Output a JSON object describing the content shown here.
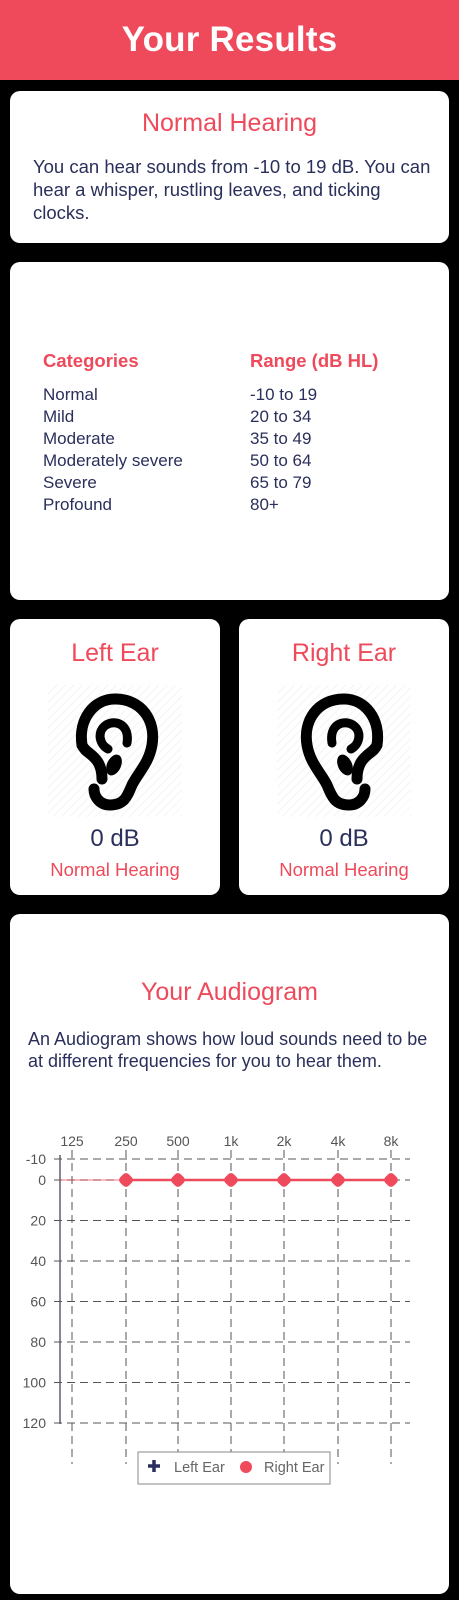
{
  "header": {
    "title": "Your Results"
  },
  "summary": {
    "title": "Normal Hearing",
    "description": "You can hear sounds from -10 to 19 dB. You can hear a whisper, rustling leaves, and ticking clocks."
  },
  "categories_table": {
    "col1_header": "Categories",
    "col2_header": "Range (dB HL)",
    "rows": [
      {
        "category": "Normal",
        "range": "-10 to 19"
      },
      {
        "category": "Mild",
        "range": "20 to 34"
      },
      {
        "category": "Moderate",
        "range": "35 to 49"
      },
      {
        "category": "Moderately severe",
        "range": "50 to 64"
      },
      {
        "category": "Severe",
        "range": "65 to 79"
      },
      {
        "category": "Profound",
        "range": "80+"
      }
    ]
  },
  "left_ear": {
    "title": "Left Ear",
    "icon": "ear-icon",
    "value": "0 dB",
    "status": "Normal Hearing"
  },
  "right_ear": {
    "title": "Right Ear",
    "icon": "ear-icon",
    "value": "0 dB",
    "status": "Normal Hearing"
  },
  "audiogram": {
    "title": "Your Audiogram",
    "description": "An Audiogram shows how loud sounds need to be at different frequencies for you to hear them."
  },
  "colors": {
    "accent": "#ee4a5b",
    "text": "#2a2f5b",
    "left_series": "#2a2f5b",
    "right_series": "#ee4a5b",
    "background": "#000000"
  },
  "chart_data": {
    "type": "line",
    "x": [
      "125",
      "250",
      "500",
      "1k",
      "2k",
      "4k",
      "8k"
    ],
    "y_ticks": [
      -10,
      0,
      20,
      40,
      60,
      80,
      100,
      120
    ],
    "ylim": [
      -10,
      120
    ],
    "y_inverted": true,
    "grid": true,
    "legend_position": "bottom",
    "series": [
      {
        "name": "Left Ear",
        "marker": "plus",
        "color": "#2a2f5b",
        "values": [
          null,
          null,
          null,
          null,
          null,
          null,
          null
        ]
      },
      {
        "name": "Right Ear",
        "marker": "circle",
        "color": "#ee4a5b",
        "values": [
          null,
          0,
          0,
          0,
          0,
          0,
          0
        ]
      }
    ]
  }
}
